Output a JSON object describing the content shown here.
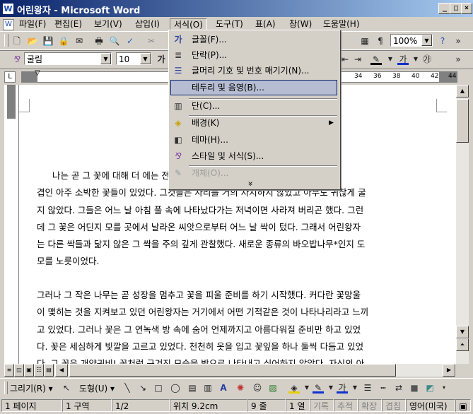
{
  "window": {
    "title": "어린왕자 - Microsoft Word",
    "app_icon": "W"
  },
  "menubar": [
    "파일(F)",
    "편집(E)",
    "보기(V)",
    "삽입(I)",
    "서식(O)",
    "도구(T)",
    "표(A)",
    "창(W)",
    "도움말(H)"
  ],
  "toolbar": {
    "zoom": "100%",
    "style": "굴림",
    "size": "10",
    "bold_glyph": "가"
  },
  "ruler": {
    "numbers": [
      "34",
      "36",
      "38",
      "40",
      "42",
      "44"
    ]
  },
  "format_menu": {
    "items": [
      {
        "label": "글꼴(F)...",
        "icon": "font-icon",
        "glyph": "가"
      },
      {
        "label": "단락(P)...",
        "icon": "paragraph-icon",
        "glyph": "≣"
      },
      {
        "label": "글머리 기호 및 번호 매기기(N)...",
        "icon": "bullets-icon",
        "glyph": "☰"
      },
      {
        "label": "테두리 및 음영(B)...",
        "icon": "",
        "glyph": ""
      },
      {
        "label": "단(C)...",
        "icon": "columns-icon",
        "glyph": "▥"
      },
      {
        "label": "배경(K)",
        "icon": "background-icon",
        "glyph": "◈"
      },
      {
        "label": "테마(H)...",
        "icon": "theme-icon",
        "glyph": "◧"
      },
      {
        "label": "스타일 및 서식(S)...",
        "icon": "styles-icon",
        "glyph": "⅋"
      },
      {
        "label": "개체(O)...",
        "icon": "object-icon",
        "glyph": "✎"
      }
    ],
    "more": "»"
  },
  "document": {
    "para1": [
      "나는 곧 그 꽃에 대해 더 에는 전부터 꽃잎이 한",
      "겹인 아주 소박한 꽃들이 있었다. 그것들은 자리를 거의 차지하지 않았고 아무도 귀찮게 굴",
      "지 않았다. 그들은 어느 날 아침 풀 속에 나타났다가는 저녁이면 사라져 버리곤 했다. 그런",
      "데 그 꽃은 어딘지 모를 곳에서 날라온 씨앗으로부터 어느 날 싹이 텄다. 그래서 어린왕자",
      "는 다른 싹들과 닮지 않은 그 싹을 주의 깊게 관찰했다. 새로운 종류의 바오밥나무*인지 도",
      "모를 노릇이었다."
    ],
    "para2": [
      "그러나 그 작은 나무는 곧 성장을 멈추고 꽃을 피울 준비를 하기 시작했다. 커다란 꽃망울",
      "이 맺히는 것을 지켜보고 있던 어린왕자는 거기에서 어떤 기적같은 것이 나타나리라고 느끼",
      "고 있었다. 그러나 꽃은 그 연녹색 방 속에 숨어 언제까지고 아름다워질 준비만 하고 있었",
      "다. 꽃은 세심하게 빛깔을 고르고 있었다. 천천히 옷을 입고 꽃잎을 하나 둘씩 다듬고 있었",
      "다. 그 꽃은 개양귀비! 꽃처럼 구겨진 모습을 밖으로 나타내고 싶어하지 않았다. 자신의 아"
    ]
  },
  "drawbar": {
    "draw": "그리기(R)",
    "autoshape": "도형(U)"
  },
  "status": [
    "1 페이지",
    "1 구역",
    "1/2",
    "위치 9.2cm",
    "9 줄",
    "1 열",
    "기록",
    "추적",
    "확장",
    "겹침",
    "영어(미국)"
  ]
}
